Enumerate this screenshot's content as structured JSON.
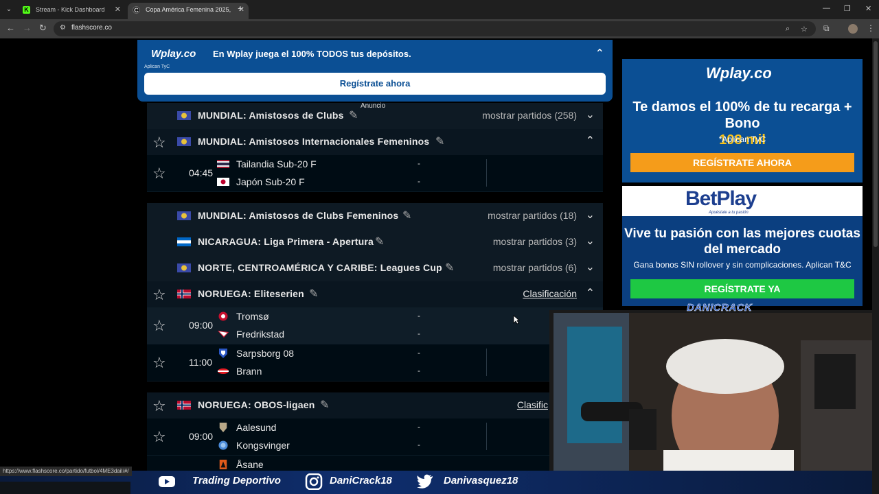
{
  "browser": {
    "tabs": [
      {
        "title": "Stream - Kick Dashboard",
        "fav": "K"
      },
      {
        "title": "Copa América Femenina 2025,",
        "fav": "C"
      }
    ],
    "url": "flashscore.co"
  },
  "top_ad": {
    "logo": "Wplay.co",
    "tyc": "Aplican TyC",
    "message": "En Wplay juega el 100% TODOS tus depósitos.",
    "cta": "Regístrate ahora",
    "anuncio": "Anuncio"
  },
  "leagues": [
    {
      "name": "MUNDIAL: Amistosos de Clubs",
      "more": "mostrar partidos (258)"
    },
    {
      "name": "MUNDIAL: Amistosos Internacionales Femeninos"
    },
    {
      "name": "MUNDIAL: Amistosos de Clubs Femeninos",
      "more": "mostrar partidos (18)"
    },
    {
      "name": "NICARAGUA: Liga Primera - Apertura",
      "more": "mostrar partidos (3)"
    },
    {
      "name": "NORTE, CENTROAMÉRICA Y CARIBE: Leagues Cup",
      "more": "mostrar partidos (6)"
    },
    {
      "name": "NORUEGA: Eliteserien",
      "more": "Clasificación"
    },
    {
      "name": "NORUEGA: OBOS-ligaen",
      "more": "Clasific"
    }
  ],
  "matches": [
    {
      "time": "04:45",
      "home": "Tailandia Sub-20 F",
      "away": "Japón Sub-20 F",
      "sh": "-",
      "sa": "-"
    },
    {
      "time": "09:00",
      "home": "Tromsø",
      "away": "Fredrikstad",
      "sh": "-",
      "sa": "-"
    },
    {
      "time": "11:00",
      "home": "Sarpsborg 08",
      "away": "Brann",
      "sh": "-",
      "sa": "-"
    },
    {
      "time": "09:00",
      "home": "Aalesund",
      "away": "Kongsvinger",
      "sh": "-",
      "sa": "-"
    },
    {
      "away": "Åsane"
    }
  ],
  "ad_wplay": {
    "logo": "Wplay.co",
    "head1": "Te damos el 100% de tu recarga + Bono",
    "head2": "108 mil",
    "sub": "*Aplican TyC",
    "cta": "REGÍSTRATE AHORA"
  },
  "ad_betplay": {
    "logo_a": "BetPlay",
    "tagline": "Apuéstale a tu pasión",
    "head": "Vive tu pasión con las mejores cuotas del mercado",
    "sub": "Gana bonos SIN rollover y sin complicaciones. Aplican T&C",
    "cta": "REGÍSTRATE YA"
  },
  "overlay": {
    "cam_label": "DANICRACK",
    "status_url": "https://www.flashscore.co/partido/futbol/4ME3daiI/#/",
    "social": [
      {
        "icon": "youtube-icon",
        "label": "Trading Deportivo"
      },
      {
        "icon": "instagram-icon",
        "label": "DaniCrack18"
      },
      {
        "icon": "twitter-icon",
        "label": "Danivasquez18"
      }
    ]
  },
  "colors": {
    "wplay_blue": "#0b4f94",
    "betplay_green": "#1ec843",
    "wplay_orange": "#f59c1a",
    "bg": "#000c14"
  }
}
